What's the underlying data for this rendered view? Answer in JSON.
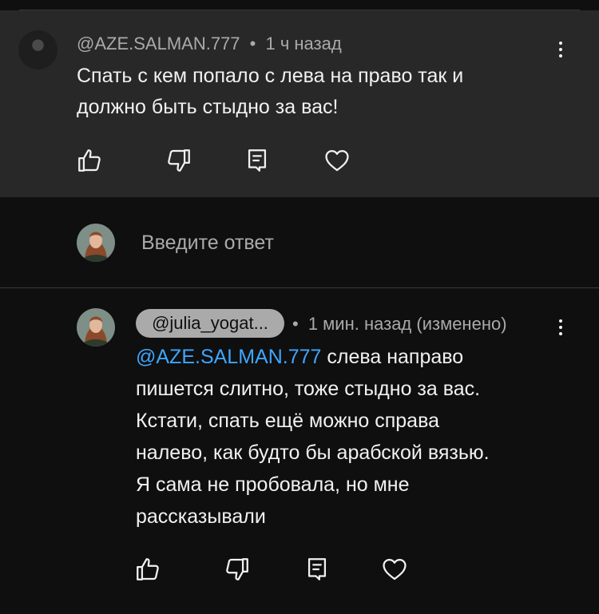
{
  "parent_comment": {
    "author": "@AZE.SALMAN.777",
    "time": "1 ч назад",
    "separator": "•",
    "lines": [
      "Спать с кем попало с лева на право так и",
      "должно быть стыдно за вас!"
    ]
  },
  "reply_box": {
    "placeholder": "Введите ответ"
  },
  "reply": {
    "author": "@julia_yogat...",
    "separator": "•",
    "time": "1 мин. назад (изменено)",
    "mention": "@AZE.SALMAN.777",
    "lines": [
      " слева направо",
      "пишется слитно, тоже стыдно за вас.",
      "Кстати, спать ещё можно справа",
      "налево, как будто бы арабской вязью.",
      "Я сама не пробовала, но мне",
      "рассказывали"
    ]
  },
  "icons": {
    "like": "thumbs-up-icon",
    "dislike": "thumbs-down-icon",
    "reply": "reply-icon",
    "heart": "heart-icon",
    "more": "more-vertical-icon"
  },
  "colors": {
    "background": "#0f0f0f",
    "highlighted_comment": "#282828",
    "text_primary": "#f1f1f1",
    "text_secondary": "#aaaaaa",
    "mention": "#3ea6ff"
  }
}
